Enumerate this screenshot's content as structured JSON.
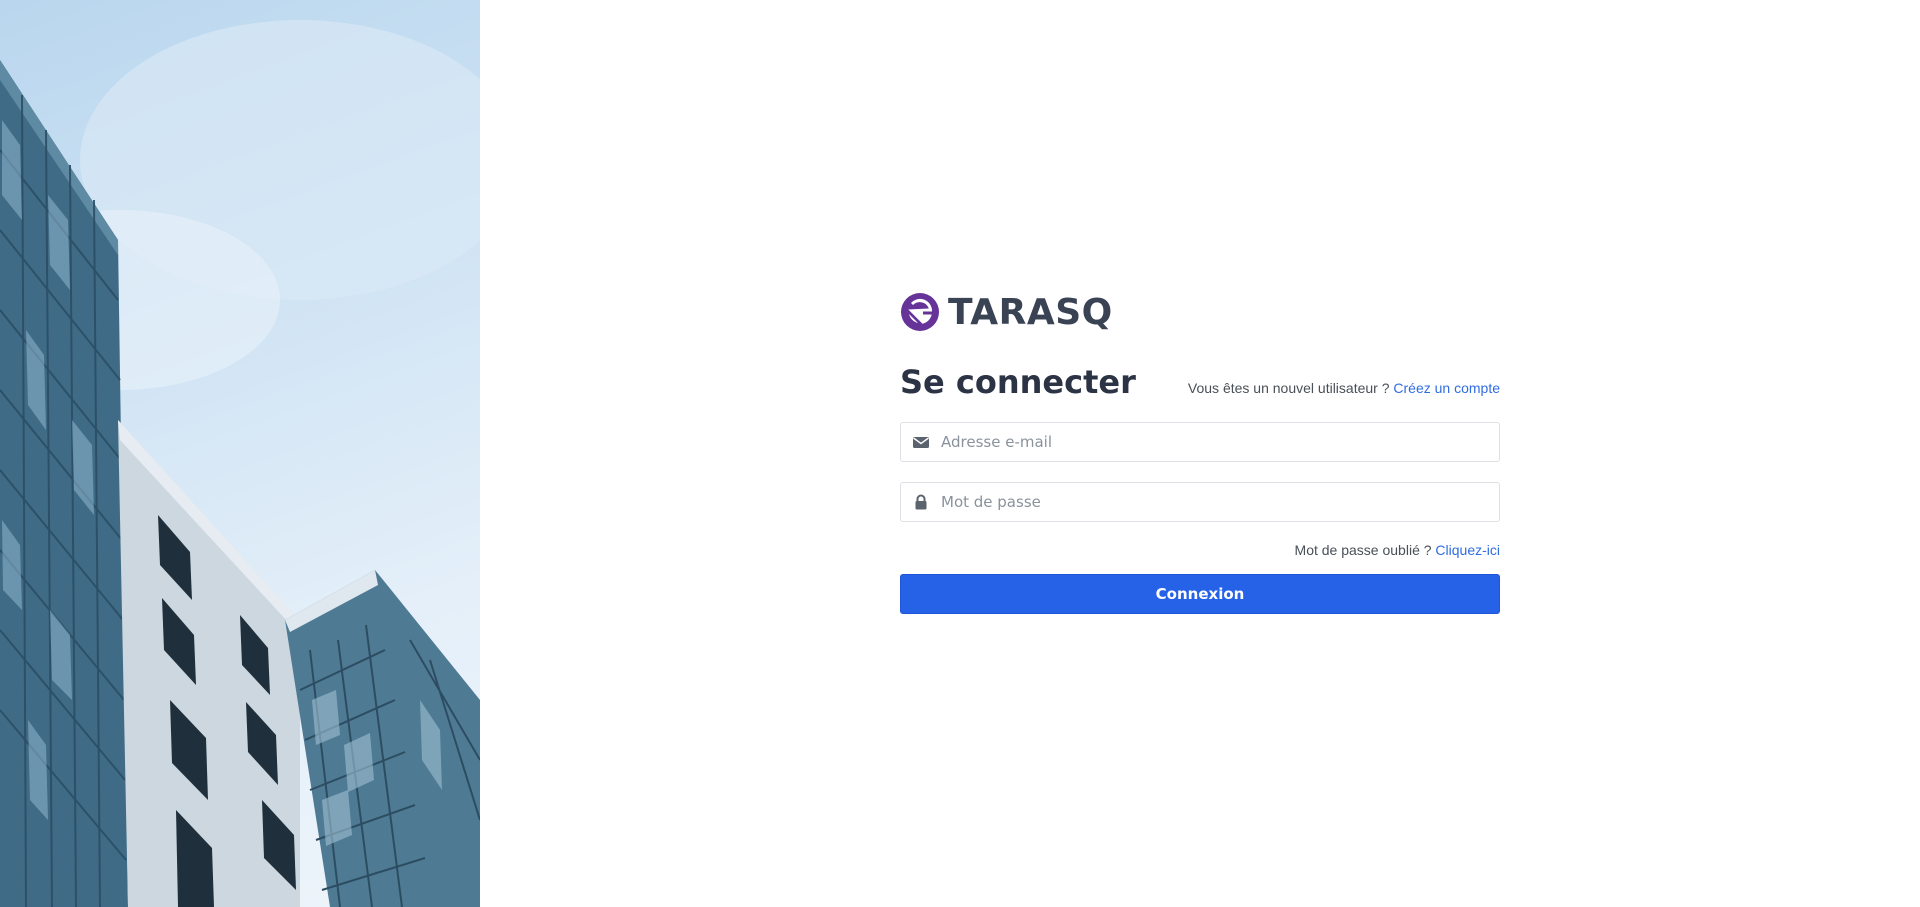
{
  "brand": {
    "name": "TARASQ",
    "logo_icon": "gatsby-logo-icon",
    "logo_color": "#663399"
  },
  "login": {
    "title": "Se connecter",
    "signup_prompt": "Vous êtes un nouvel utilisateur ?",
    "signup_link": "Créez un compte",
    "email_placeholder": "Adresse e-mail",
    "email_icon": "envelope-icon",
    "password_placeholder": "Mot de passe",
    "password_icon": "lock-icon",
    "forgot_prompt": "Mot de passe oublié ?",
    "forgot_link": "Cliquez-ici",
    "submit_label": "Connexion"
  },
  "colors": {
    "primary": "#2662e8",
    "link": "#2f6de1",
    "heading": "#2b3344"
  },
  "hero": {
    "image": "building-photo"
  }
}
